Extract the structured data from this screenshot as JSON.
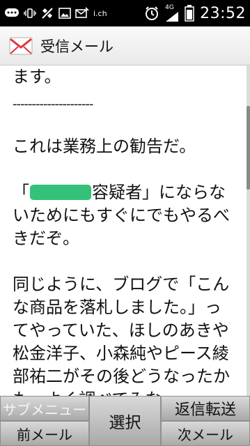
{
  "status_bar": {
    "clock": "23:52",
    "ich_label": "i.ch",
    "network_label": "4G",
    "icons": [
      "chat-bubble-icon",
      "vibrate-icon",
      "signal-off-icon",
      "image-icon",
      "mail-notify-icon",
      "alarm-icon",
      "signal-bars-icon",
      "battery-icon"
    ]
  },
  "titlebar": {
    "title": "受信メール",
    "icon": "envelope-icon"
  },
  "message": {
    "lines_top": [
      "ます。"
    ],
    "divider": "---------------------",
    "para1": [
      "これは業務上の勧告だ。"
    ],
    "para2_line1_prefix": "「",
    "para2_line1_suffix": "容疑者」にならな",
    "para2_rest": [
      "いためにもすぐにでもやるべ",
      "きだぞ。"
    ],
    "para3": [
      "同じように、ブログで「こん",
      "な商品を落札しました。」っ",
      "てやっていた、ほしのあきや",
      "松金洋子、小森純やピース綾",
      "部祐二がその後どうなったか",
      "も、よく調べてみな。"
    ]
  },
  "softkeys": {
    "submenu": "サブメニュー",
    "prev_mail": "前メール",
    "select": "選択",
    "reply_forward": "返信転送",
    "next_mail": "次メール"
  },
  "colors": {
    "redaction": "#35c17a",
    "statusbar_bg": "#000000",
    "softkey_bg": "#bdbdbd"
  }
}
